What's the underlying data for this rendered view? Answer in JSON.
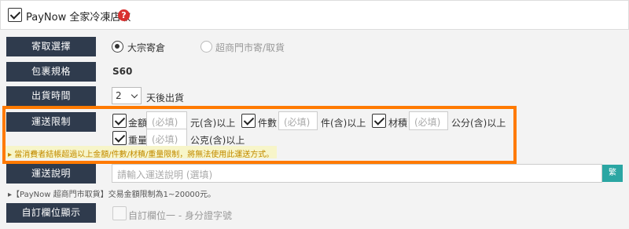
{
  "header": {
    "title": "PayNow 全家冷凍店取",
    "help": "?"
  },
  "pickup": {
    "label": "寄取選擇",
    "option_bulk": "大宗寄倉",
    "option_store": "超商門市寄/取貨"
  },
  "package": {
    "label": "包裹規格",
    "value": "S60"
  },
  "ship_time": {
    "label": "出貨時間",
    "value": "2",
    "suffix": "天後出貨"
  },
  "limits": {
    "label": "運送限制",
    "amount": {
      "label": "金額",
      "placeholder": "(必填)",
      "unit": "元(含)以上"
    },
    "count": {
      "label": "件數",
      "placeholder": "(必填)",
      "unit": "件(含)以上"
    },
    "size": {
      "label": "材積",
      "placeholder": "(必填)",
      "unit": "公分(含)以上"
    },
    "weight": {
      "label": "重量",
      "placeholder": "(必填)",
      "unit": "公克(含)以上"
    },
    "note": "▸ 當消費者結帳超過以上金額/件數/材積/重量限制，將無法使用此運送方式。"
  },
  "description": {
    "label": "運送說明",
    "placeholder": "請輸入運送說明 (選填)",
    "button": "繁"
  },
  "footnote": "▸【PayNow 超商門市取貨】交易金額限制為1~20000元。",
  "custom_field": {
    "label": "自訂欄位顯示",
    "option": "自訂欄位一 - 身分證字號"
  }
}
